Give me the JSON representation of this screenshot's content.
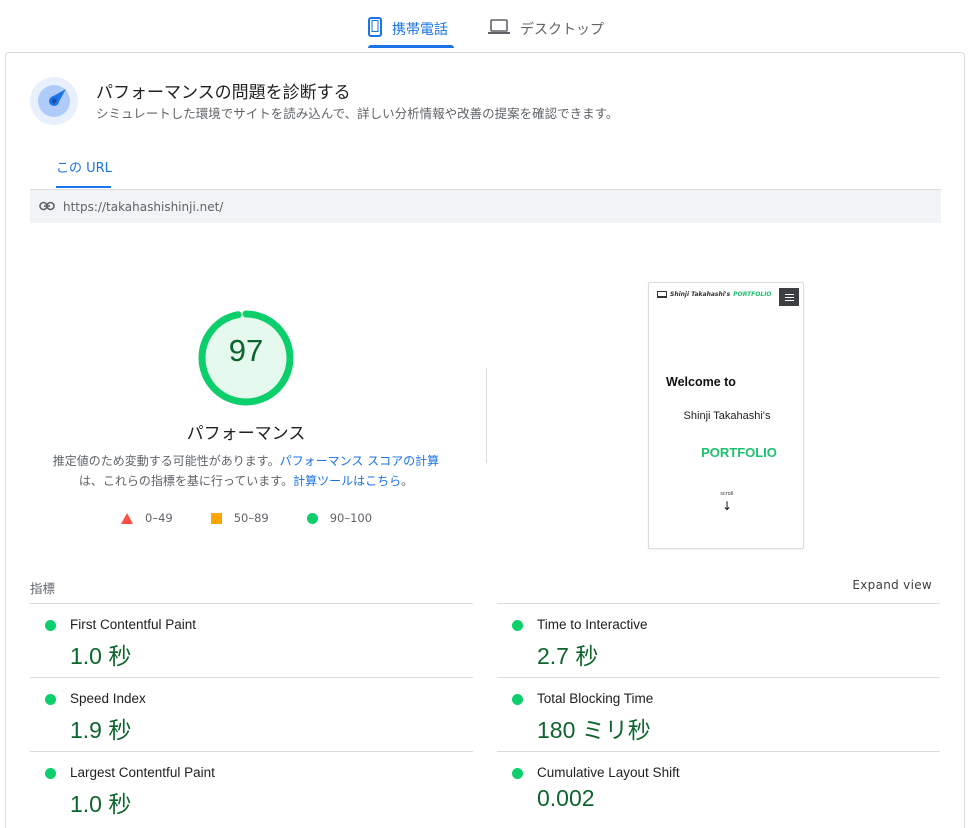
{
  "device_tabs": [
    {
      "label": "携帯電話",
      "icon": "smartphone-icon",
      "active": true
    },
    {
      "label": "デスクトップ",
      "icon": "laptop-icon",
      "active": false
    }
  ],
  "header": {
    "title": "パフォーマンスの問題を診断する",
    "subtitle": "シミュレートした環境でサイトを読み込んで、詳しい分析情報や改善の提案を確認できます。",
    "icon": "compass-icon"
  },
  "url_tab": {
    "label": "この URL"
  },
  "url_bar": {
    "url": "https://takahashishinji.net/",
    "icon": "link-icon"
  },
  "gauge": {
    "score": "97",
    "label": "パフォーマンス",
    "note_line1": "推定値のため変動する可能性があります。",
    "note_link1": "パフォーマンス スコアの計算",
    "note_line2": "は、これらの指標を基に行っています。",
    "note_link2": "計算ツールはこちら",
    "note_end": "。",
    "color": "#0cce6b"
  },
  "legend": [
    {
      "shape": "triangle",
      "range": "0–49",
      "color": "#ff4e42"
    },
    {
      "shape": "square",
      "range": "50–89",
      "color": "#ffa400"
    },
    {
      "shape": "circle",
      "range": "90–100",
      "color": "#0cce6b"
    }
  ],
  "preview": {
    "brand_prefix": "Shinji Takahashi's",
    "brand_suffix": "PORTFOLIO",
    "welcome": "Welcome to",
    "name": "Shinji Takahashi's",
    "portfolio": "PORTFOLIO",
    "scroll": "scroll",
    "arrow": "↓"
  },
  "metrics": {
    "title": "指標",
    "expand_label": "Expand view",
    "left": [
      {
        "name": "First Contentful Paint",
        "value": "1.0 秒"
      },
      {
        "name": "Speed Index",
        "value": "1.9 秒"
      },
      {
        "name": "Largest Contentful Paint",
        "value": "1.0 秒"
      }
    ],
    "right": [
      {
        "name": "Time to Interactive",
        "value": "2.7 秒"
      },
      {
        "name": "Total Blocking Time",
        "value": "180 ミリ秒"
      },
      {
        "name": "Cumulative Layout Shift",
        "value": "0.002"
      }
    ]
  }
}
